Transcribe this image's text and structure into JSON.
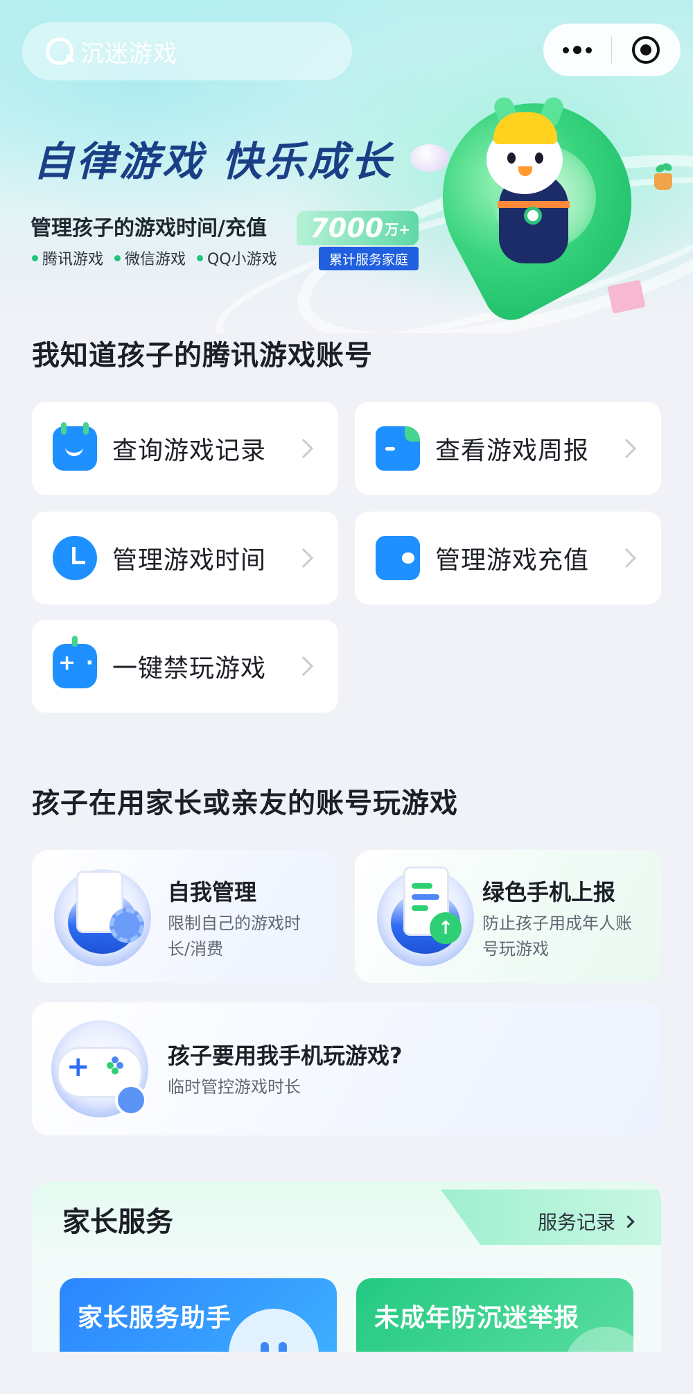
{
  "search": {
    "placeholder": "沉迷游戏"
  },
  "hero": {
    "title": "自律游戏  快乐成长",
    "subtitle": "管理孩子的游戏时间/充值",
    "platforms": [
      "腾讯游戏",
      "微信游戏",
      "QQ小游戏"
    ],
    "stat_number": "7000",
    "stat_unit": "万+",
    "stat_label": "累计服务家庭"
  },
  "section_known": {
    "title": "我知道孩子的腾讯游戏账号",
    "items": [
      {
        "label": "查询游戏记录",
        "icon": "calendar-icon"
      },
      {
        "label": "查看游戏周报",
        "icon": "report-icon"
      },
      {
        "label": "管理游戏时间",
        "icon": "clock-icon"
      },
      {
        "label": "管理游戏充值",
        "icon": "wallet-icon"
      },
      {
        "label": "一键禁玩游戏",
        "icon": "gamepad-icon"
      }
    ]
  },
  "section_parent_account": {
    "title": "孩子在用家长或亲友的账号玩游戏",
    "cards": [
      {
        "title": "自我管理",
        "desc_line1": "限制自己的游戏时",
        "desc_line2": "长/消费",
        "icon": "self-manage-icon"
      },
      {
        "title": "绿色手机上报",
        "desc_line1": "防止孩子用成年人账",
        "desc_line2": "号玩游戏",
        "icon": "phone-report-icon"
      },
      {
        "title": "孩子要用我手机玩游戏?",
        "desc_line1": "临时管控游戏时长",
        "icon": "gamepad-clock-icon"
      }
    ]
  },
  "parent_services": {
    "title": "家长服务",
    "record_link": "服务记录",
    "cards": [
      {
        "label": "家长服务助手"
      },
      {
        "label": "未成年防沉迷举报"
      }
    ]
  },
  "colors": {
    "brand_blue": "#1e90ff",
    "brand_green": "#47d48f",
    "title_navy": "#1b3f86",
    "page_bg": "#f1f2f7"
  }
}
